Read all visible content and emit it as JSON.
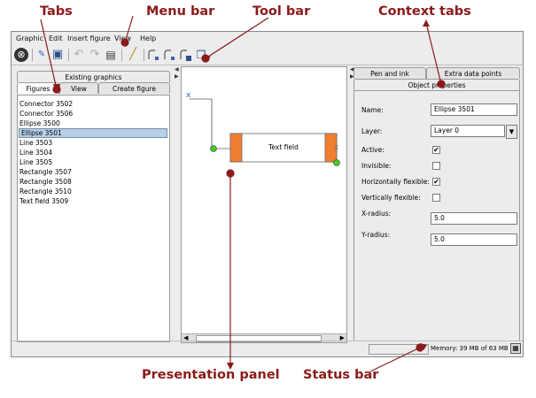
{
  "annotations": {
    "tabs": "Tabs",
    "menu_bar": "Menu bar",
    "tool_bar": "Tool bar",
    "context_tabs": "Context tabs",
    "presentation_panel": "Presentation panel",
    "status_bar": "Status bar"
  },
  "colors": {
    "annotation": "#8b1a1a",
    "selection": "#b8cfe5",
    "accent_orange": "#f08030",
    "handle_green": "#44cc22"
  },
  "menubar": {
    "items": [
      "Graphic",
      "Edit",
      "Insert figure",
      "View",
      "Help"
    ]
  },
  "toolbar": {
    "icons": [
      "new-icon",
      "open-icon",
      "save-icon",
      "undo-icon",
      "redo-icon",
      "list-icon",
      "draw-icon",
      "connector-icon-1",
      "connector-icon-2",
      "connector-icon-3",
      "copy-icon"
    ]
  },
  "left_panel": {
    "tab_top": "Existing graphics",
    "tabs": [
      "Figures",
      "View",
      "Create figure"
    ],
    "selected_tab": "Figures",
    "items": [
      "Connector 3502",
      "Connector 3506",
      "Ellipse 3500",
      "Ellipse 3501",
      "Line 3503",
      "Line 3504",
      "Line 3505",
      "Rectangle 3507",
      "Rectangle 3508",
      "Rectangle 3510",
      "Text field 3509"
    ],
    "selected_item": "Ellipse 3501"
  },
  "canvas": {
    "text_field_label": "Text field",
    "marker": "x"
  },
  "right_panel": {
    "tabs_back": [
      "Pen and ink",
      "Extra data points"
    ],
    "tab_front": "Object properties",
    "fields": {
      "name_label": "Name:",
      "name_value": "Ellipse 3501",
      "layer_label": "Layer:",
      "layer_value": "Layer 0",
      "active_label": "Active:",
      "active_checked": true,
      "invisible_label": "Invisible:",
      "invisible_checked": false,
      "hflex_label": "Horizontally flexible:",
      "hflex_checked": true,
      "vflex_label": "Vertically flexible:",
      "vflex_checked": false,
      "xradius_label": "X-radius:",
      "xradius_value": "5.0",
      "yradius_label": "Y-radius:",
      "yradius_value": "5.0"
    }
  },
  "statusbar": {
    "memory": "Memory: 39 MB of 63 MB"
  },
  "glyphs": {
    "check": "✔",
    "dropdown": "▼",
    "scroll_left": "◀",
    "scroll_right": "▶",
    "splitter_left": "◀",
    "splitter_right": "▶",
    "new": "⊗",
    "undo": "↶",
    "redo": "↷",
    "draw": "╱",
    "list": "▤",
    "save": "▣",
    "open": "✎",
    "copy": "❐",
    "trash": "▦"
  }
}
